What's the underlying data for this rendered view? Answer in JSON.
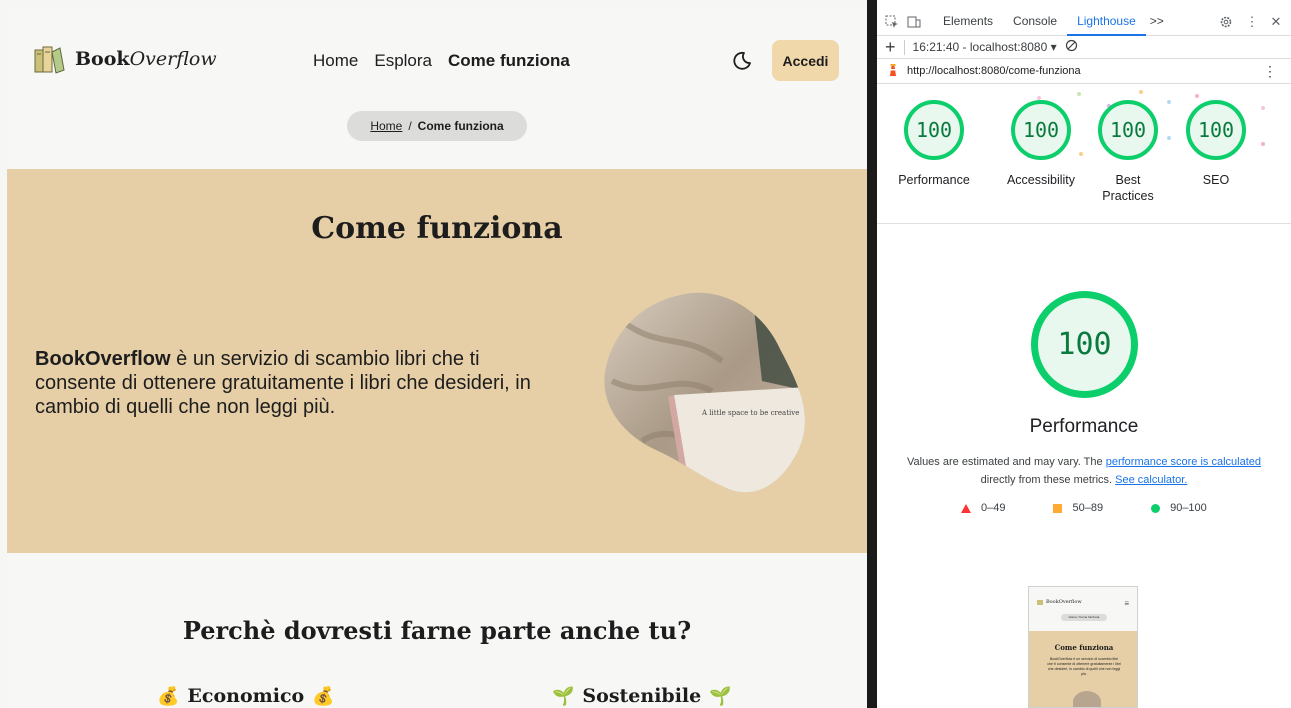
{
  "site": {
    "logo": {
      "brand_bold": "Book",
      "brand_italic": "Overflow"
    },
    "nav": [
      {
        "label": "Home",
        "active": false
      },
      {
        "label": "Esplora",
        "active": false
      },
      {
        "label": "Come funziona",
        "active": true
      }
    ],
    "login_label": "Accedi",
    "breadcrumb": {
      "home": "Home",
      "separator": "/",
      "current": "Come funziona"
    },
    "hero": {
      "title": "Come funziona",
      "text_bold": "BookOverflow",
      "text_rest": " è un servizio di scambio libri che ti consente di ottenere gratuitamente i libri che desideri, in cambio di quelli che non leggi più.",
      "image_caption": "A little space to be creative"
    },
    "why": {
      "title": "Perchè dovresti farne parte anche tu?",
      "features": [
        {
          "label": "Economico",
          "icon": "💰"
        },
        {
          "label": "Sostenibile",
          "icon": "🌱"
        }
      ]
    },
    "colors": {
      "hero_bg": "#e6cfa6",
      "accent_button": "#f0d8ab"
    }
  },
  "devtools": {
    "tabs": [
      "Elements",
      "Console",
      "Lighthouse"
    ],
    "more_tabs": ">>",
    "active_tab": "Lighthouse",
    "session": "16:21:40 - localhost:8080",
    "url": "http://localhost:8080/come-funziona",
    "scores": [
      {
        "label": "Performance",
        "value": "100"
      },
      {
        "label": "Accessibility",
        "value": "100"
      },
      {
        "label": "Best Practices",
        "value": "100"
      },
      {
        "label": "SEO",
        "value": "100"
      }
    ],
    "performance": {
      "score": "100",
      "title": "Performance",
      "desc_prefix": "Values are estimated and may vary. The ",
      "desc_link1": "performance score is calculated",
      "desc_middle": " directly from these metrics. ",
      "desc_link2": "See calculator."
    },
    "legend": [
      {
        "range": "0–49",
        "color": "#ff3333"
      },
      {
        "range": "50–89",
        "color": "#ffaa33"
      },
      {
        "range": "90–100",
        "color": "#0cce6b"
      }
    ],
    "thumbnail": {
      "brand": "BookOverflow",
      "crumb": "Home / Come funziona",
      "title": "Come funziona",
      "text": "BookOverflow è un servizio di scambio libri che ti consente di ottenere gratuitamente i libri che desideri, in cambio di quelli che non leggi più."
    },
    "colors": {
      "pass": "#0cce6b",
      "link": "#1a73e8"
    }
  }
}
